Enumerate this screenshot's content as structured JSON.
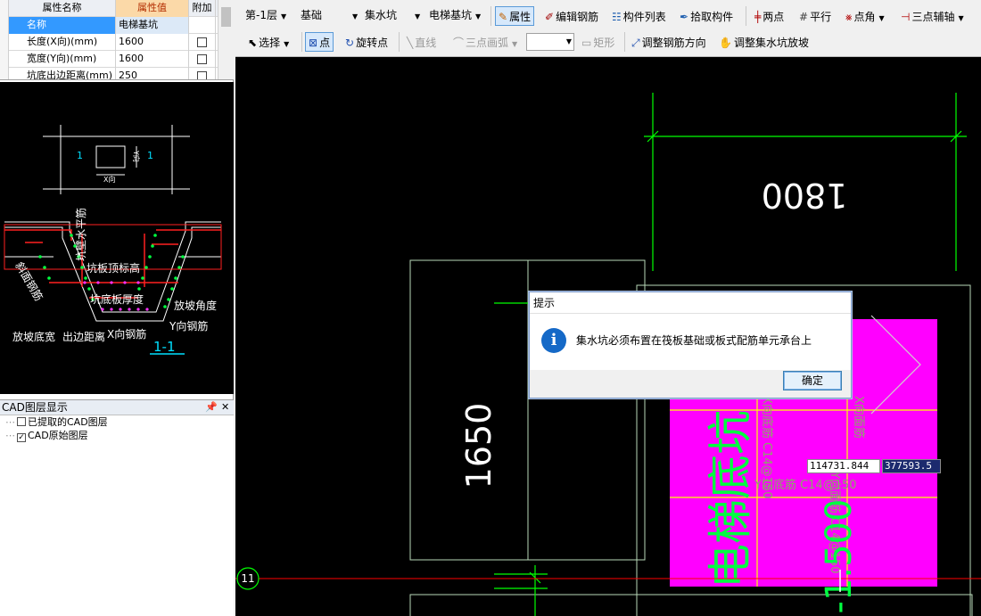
{
  "properties": {
    "headers": {
      "name": "属性名称",
      "value": "属性值",
      "extra": "附加"
    },
    "rows": [
      {
        "name": "名称",
        "value": "电梯基坑"
      },
      {
        "name": "长度(X向)(mm)",
        "value": "1600"
      },
      {
        "name": "宽度(Y向)(mm)",
        "value": "1600"
      },
      {
        "name": "坑底出边距离(mm)",
        "value": "250"
      }
    ]
  },
  "preview": {
    "labels": {
      "x_dir": "X向",
      "y_dir": "Y向",
      "marker": "1",
      "wall_rebar": "坑壁水平筋",
      "top_elevation": "坑板顶标高",
      "bottom_thickness": "坑底板厚度",
      "slope_angle": "放坡角度",
      "y_rebar": "Y向钢筋",
      "slope_width": "放坡底宽",
      "edge_distance": "出边距离",
      "x_rebar": "X向钢筋",
      "slope_rebar": "斜面钢筋",
      "section": "1-1"
    }
  },
  "layers": {
    "title": "CAD图层显示",
    "items": [
      {
        "label": "已提取的CAD图层",
        "checked": false
      },
      {
        "label": "CAD原始图层",
        "checked": true
      }
    ]
  },
  "toolbar": {
    "floor": "第-1层",
    "category": "基础",
    "type": "集水坑",
    "component": "电梯基坑",
    "property_btn": "属性",
    "edit_rebar_btn": "编辑钢筋",
    "component_list_btn": "构件列表",
    "pick_component_btn": "拾取构件",
    "two_points_btn": "两点",
    "parallel_btn": "平行",
    "point_angle_btn": "点角",
    "three_point_aux_btn": "三点辅轴",
    "select_btn": "选择",
    "point_btn": "点",
    "rotate_point_btn": "旋转点",
    "line_btn": "直线",
    "arc_btn": "三点画弧",
    "rect_btn": "矩形",
    "adjust_rebar_dir_btn": "调整钢筋方向",
    "adjust_pit_slope_btn": "调整集水坑放坡"
  },
  "canvas": {
    "dim_1800": "1800",
    "dim_1650": "1650",
    "pit_label": "电梯底坑",
    "pit_elevation": "-1.500",
    "faded_labels": [
      "X向底筋 C14@150",
      "Y向底筋 C14@150",
      "X向面筋",
      "Y向面筋 C14@150"
    ],
    "axis_label": "11",
    "coord_x": "114731.844",
    "coord_y": "377593.5",
    "colors": {
      "pit_fill": "#ff00ff",
      "axis": "#00ff00",
      "grid": "#ffff00",
      "axis_line": "#ff0000"
    }
  },
  "dialog": {
    "title": "提示",
    "message": "集水坑必须布置在筏板基础或板式配筋单元承台上",
    "ok_label": "确定"
  }
}
